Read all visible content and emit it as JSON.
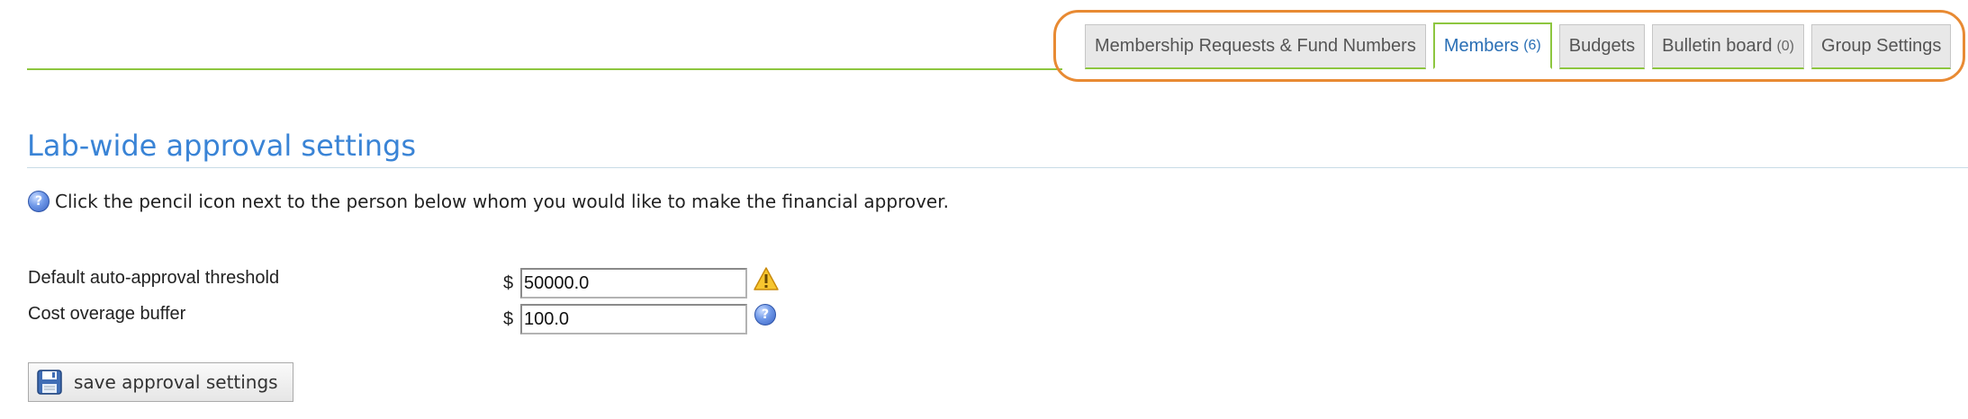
{
  "tabs": [
    {
      "label": "Membership Requests & Fund Numbers",
      "count": "",
      "active": false
    },
    {
      "label": "Members",
      "count": "(6)",
      "active": true
    },
    {
      "label": "Budgets",
      "count": "",
      "active": false
    },
    {
      "label": "Bulletin board",
      "count": "(0)",
      "active": false
    },
    {
      "label": "Group Settings",
      "count": "",
      "active": false
    }
  ],
  "section": {
    "title": "Lab-wide approval settings",
    "info_text": "Click the pencil icon next to the person below whom you would like to make the financial approver."
  },
  "form": {
    "currency_symbol": "$",
    "auto_approval": {
      "label": "Default auto-approval threshold",
      "value": "50000.0",
      "icon": "warning-icon"
    },
    "overage_buffer": {
      "label": "Cost overage buffer",
      "value": "100.0",
      "icon": "help-icon"
    }
  },
  "save_button": {
    "label": "save approval settings",
    "icon": "floppy-disk-icon"
  },
  "colors": {
    "accent_green": "#8dc63f",
    "title_blue": "#3a84d6",
    "active_tab_text": "#2a6fb5",
    "highlight_orange": "#e88a33"
  },
  "icons": {
    "info": "?",
    "help": "?"
  }
}
